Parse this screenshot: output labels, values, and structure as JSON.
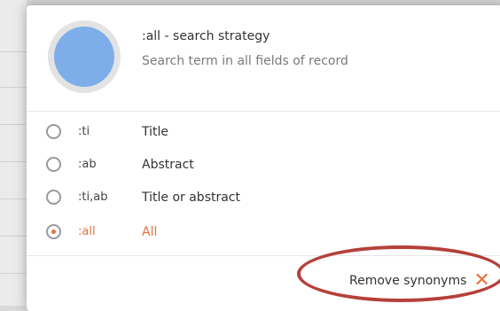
{
  "header": {
    "title": ":all - search strategy",
    "subtitle": "Search term in all fields of record"
  },
  "options": [
    {
      "code": ":ti",
      "label": "Title",
      "selected": false
    },
    {
      "code": ":ab",
      "label": "Abstract",
      "selected": false
    },
    {
      "code": ":ti,ab",
      "label": "Title or abstract",
      "selected": false
    },
    {
      "code": ":all",
      "label": "All",
      "selected": true
    }
  ],
  "footer": {
    "remove_label": "Remove synonyms",
    "remove_icon": "close-icon"
  },
  "colors": {
    "accent": "#e8703a",
    "avatar": "#7daeea",
    "highlight_ellipse": "#b5403b"
  }
}
